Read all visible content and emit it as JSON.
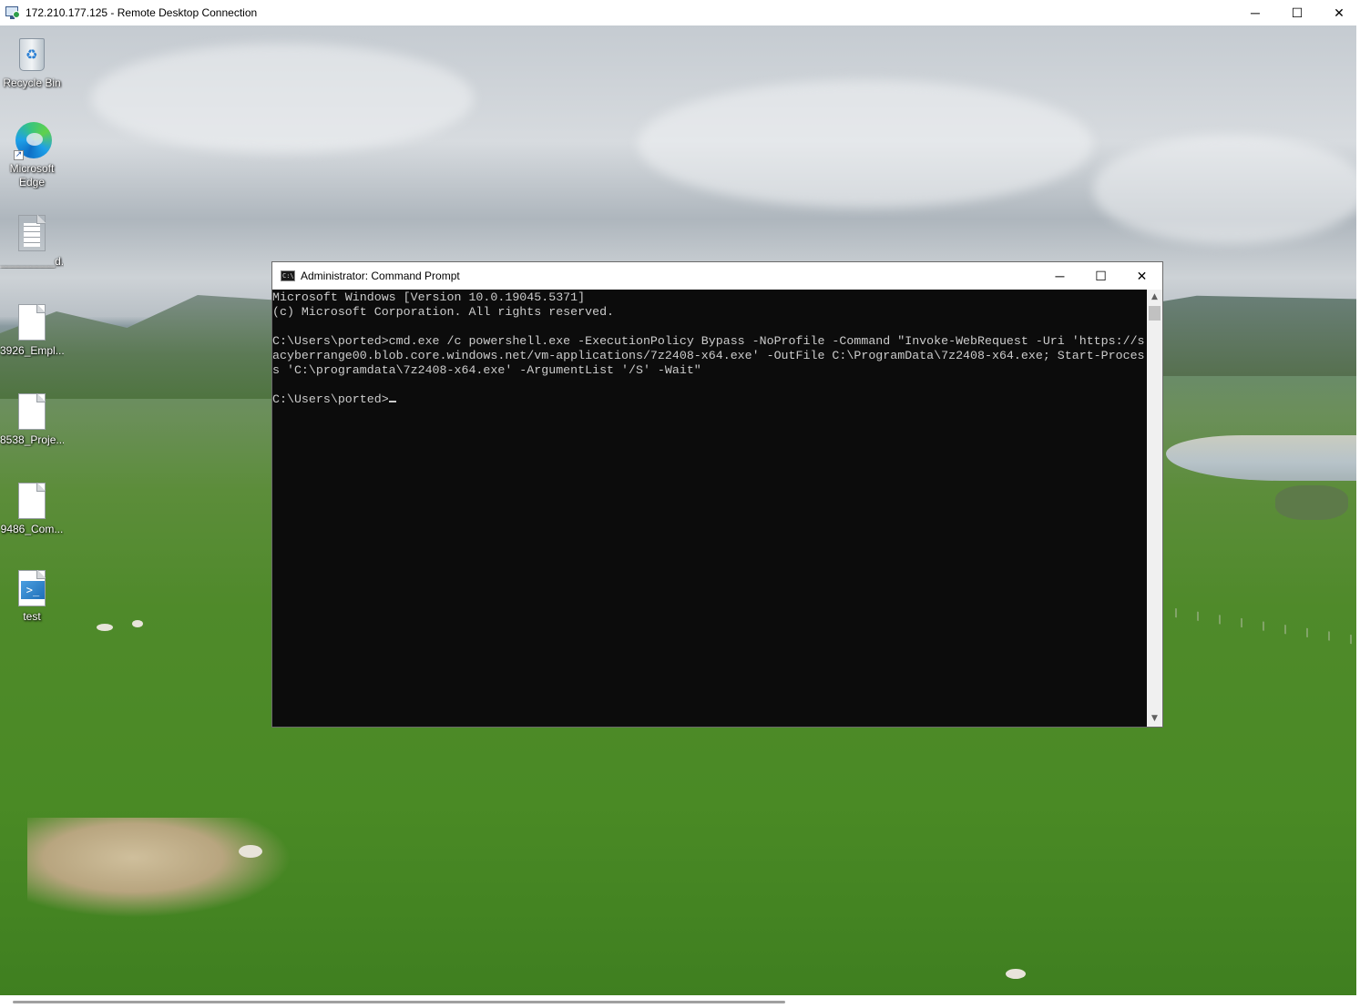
{
  "rdp": {
    "title": "172.210.177.125 - Remote Desktop Connection",
    "minimize": "─",
    "maximize": "☐",
    "close": "✕"
  },
  "desktop_icons": [
    {
      "label": "Recycle Bin",
      "icon": "recycle-bin-icon"
    },
    {
      "label": "Microsoft Edge",
      "icon": "edge-icon"
    },
    {
      "label": "_________d...",
      "icon": "text-document-icon"
    },
    {
      "label": "3926_Empl...",
      "icon": "file-icon"
    },
    {
      "label": "8538_Proje...",
      "icon": "file-icon"
    },
    {
      "label": "9486_Com...",
      "icon": "file-icon"
    },
    {
      "label": "test",
      "icon": "powershell-script-icon"
    }
  ],
  "cmd": {
    "title": "Administrator: Command Prompt",
    "minimize": "─",
    "maximize": "☐",
    "close": "✕",
    "lines": [
      "Microsoft Windows [Version 10.0.19045.5371]",
      "(c) Microsoft Corporation. All rights reserved.",
      "",
      "C:\\Users\\ported>cmd.exe /c powershell.exe -ExecutionPolicy Bypass -NoProfile -Command \"Invoke-WebRequest -Uri 'https://s",
      "acyberrange00.blob.core.windows.net/vm-applications/7z2408-x64.exe' -OutFile C:\\ProgramData\\7z2408-x64.exe; Start-Proces",
      "s 'C:\\programdata\\7z2408-x64.exe' -ArgumentList '/S' -Wait\"",
      ""
    ],
    "prompt": "C:\\Users\\ported>"
  }
}
